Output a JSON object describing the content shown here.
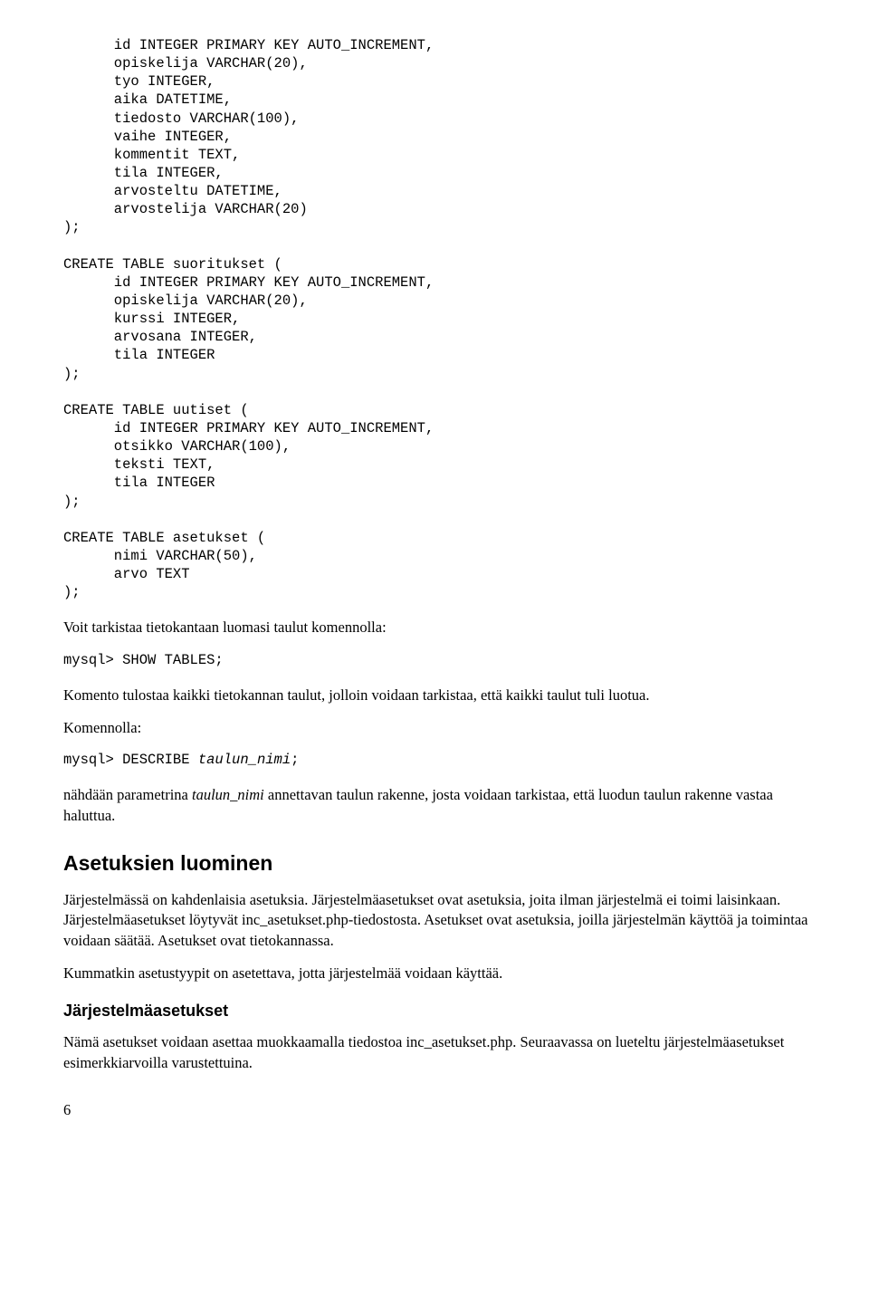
{
  "code_block_1": "      id INTEGER PRIMARY KEY AUTO_INCREMENT,\n      opiskelija VARCHAR(20),\n      tyo INTEGER,\n      aika DATETIME,\n      tiedosto VARCHAR(100),\n      vaihe INTEGER,\n      kommentit TEXT,\n      tila INTEGER,\n      arvosteltu DATETIME,\n      arvostelija VARCHAR(20)\n);\n\nCREATE TABLE suoritukset (\n      id INTEGER PRIMARY KEY AUTO_INCREMENT,\n      opiskelija VARCHAR(20),\n      kurssi INTEGER,\n      arvosana INTEGER,\n      tila INTEGER\n);\n\nCREATE TABLE uutiset (\n      id INTEGER PRIMARY KEY AUTO_INCREMENT,\n      otsikko VARCHAR(100),\n      teksti TEXT,\n      tila INTEGER\n);\n\nCREATE TABLE asetukset (\n      nimi VARCHAR(50),\n      arvo TEXT\n);",
  "para1": "Voit tarkistaa tietokantaan luomasi taulut komennolla:",
  "code_line_1": "mysql> SHOW TABLES;",
  "para2": "Komento tulostaa kaikki tietokannan taulut, jolloin voidaan tarkistaa, että kaikki taulut tuli luotua.",
  "para3": "Komennolla:",
  "code_line_2_pre": "mysql> DESCRIBE ",
  "code_line_2_italic": "taulun_nimi",
  "code_line_2_post": ";",
  "para4_a": "nähdään parametrina ",
  "para4_italic": "taulun_nimi",
  "para4_b": " annettavan taulun rakenne, josta voidaan tarkistaa, että luodun taulun rakenne vastaa haluttua.",
  "h2": "Asetuksien luominen",
  "para5": "Järjestelmässä on kahdenlaisia asetuksia. Järjestelmäasetukset ovat asetuksia, joita ilman järjestelmä ei toimi laisinkaan. Järjestelmäasetukset löytyvät inc_asetukset.php-tiedostosta. Asetukset ovat asetuksia, joilla järjestelmän käyttöä ja toimintaa voidaan säätää. Asetukset ovat tietokannassa.",
  "para6": "Kummatkin asetustyypit on asetettava, jotta järjestelmää voidaan käyttää.",
  "h3": "Järjestelmäasetukset",
  "para7": "Nämä asetukset voidaan asettaa muokkaamalla tiedostoa inc_asetukset.php. Seuraavassa on lueteltu järjestelmäasetukset esimerkkiarvoilla varustettuina.",
  "page_num": "6"
}
